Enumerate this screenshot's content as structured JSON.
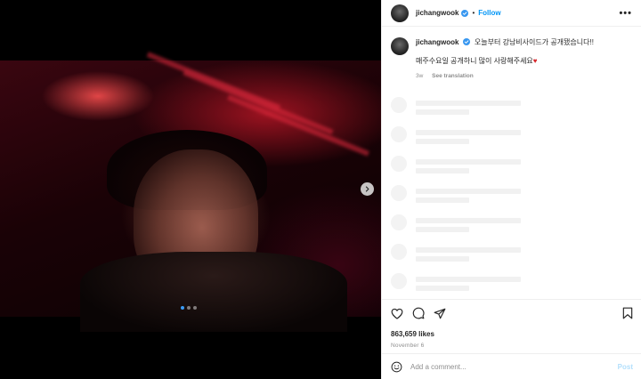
{
  "post": {
    "username": "jichangwook",
    "follow_label": "Follow",
    "separator": "•",
    "more_label": "•••",
    "caption_line1": "오늘부터 강남비사이드가 공개됐습니다!!",
    "caption_line2": "매주수요일 공개하니 많이 사랑해주세요",
    "caption_emoji": "♥",
    "time_ago": "3w",
    "see_translation": "See translation",
    "likes": "863,659 likes",
    "date": "November 6"
  },
  "media": {
    "slide_count": 3,
    "current_slide": 1
  },
  "comment": {
    "placeholder": "Add a comment...",
    "post_label": "Post"
  },
  "colors": {
    "accent": "#0095f6",
    "verified": "#3897f0"
  }
}
